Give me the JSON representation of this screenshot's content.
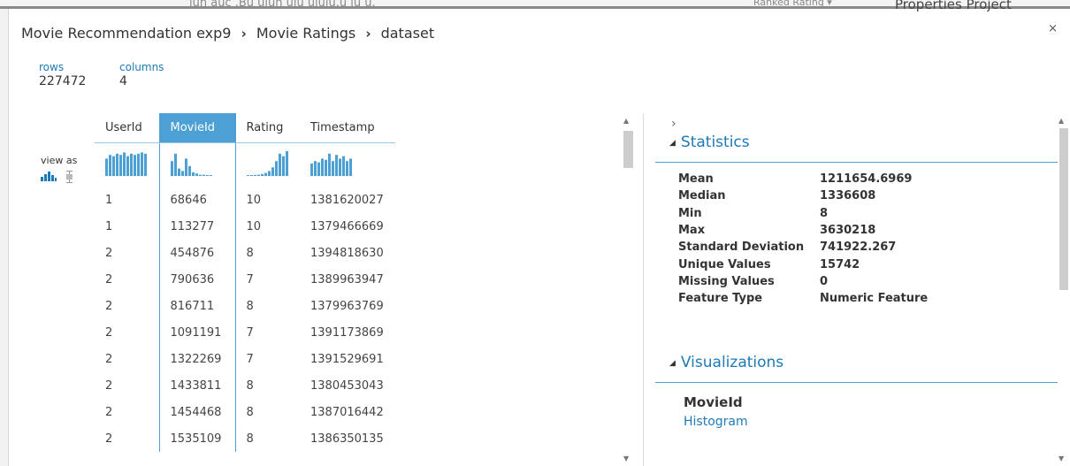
{
  "background": {
    "ghost_text_left": "lun auc  ,Bu ulun ulu ululu.u lu u.",
    "ghost_text_right": "Properties   Project",
    "ghost_text_mid": "Ranked Rating ▾"
  },
  "breadcrumb": {
    "experiment": "Movie Recommendation exp9",
    "module": "Movie Ratings",
    "port": "dataset",
    "separator": "›"
  },
  "close_label": "×",
  "summary": {
    "rows_label": "rows",
    "rows_value": "227472",
    "columns_label": "columns",
    "columns_value": "4"
  },
  "view_as_label": "view as",
  "table": {
    "columns": [
      "UserId",
      "MovieId",
      "Rating",
      "Timestamp"
    ],
    "selected_column": 1,
    "rows": [
      [
        "1",
        "68646",
        "10",
        "1381620027"
      ],
      [
        "1",
        "113277",
        "10",
        "1379466669"
      ],
      [
        "2",
        "454876",
        "8",
        "1394818630"
      ],
      [
        "2",
        "790636",
        "7",
        "1389963947"
      ],
      [
        "2",
        "816711",
        "8",
        "1379963769"
      ],
      [
        "2",
        "1091191",
        "7",
        "1391173869"
      ],
      [
        "2",
        "1322269",
        "7",
        "1391529691"
      ],
      [
        "2",
        "1433811",
        "8",
        "1380453043"
      ],
      [
        "2",
        "1454468",
        "8",
        "1387016442"
      ],
      [
        "2",
        "1535109",
        "8",
        "1386350135"
      ]
    ]
  },
  "statistics": {
    "heading": "Statistics",
    "items": [
      {
        "label": "Mean",
        "value": "1211654.6969"
      },
      {
        "label": "Median",
        "value": "1336608"
      },
      {
        "label": "Min",
        "value": "8"
      },
      {
        "label": "Max",
        "value": "3630218"
      },
      {
        "label": "Standard Deviation",
        "value": "741922.267"
      },
      {
        "label": "Unique Values",
        "value": "15742"
      },
      {
        "label": "Missing Values",
        "value": "0"
      },
      {
        "label": "Feature Type",
        "value": "Numeric Feature"
      }
    ]
  },
  "visualizations": {
    "heading": "Visualizations",
    "column_name": "MovieId",
    "link": "Histogram"
  },
  "colors": {
    "accent": "#1e7ab7",
    "selected_header": "#4da0d3",
    "spark_bar": "#4da0d3"
  },
  "icons": {
    "histogram_view": "histogram-icon",
    "boxplot_view": "boxplot-icon",
    "expand": "chevron-right-icon",
    "collapse": "triangle-down-icon"
  }
}
